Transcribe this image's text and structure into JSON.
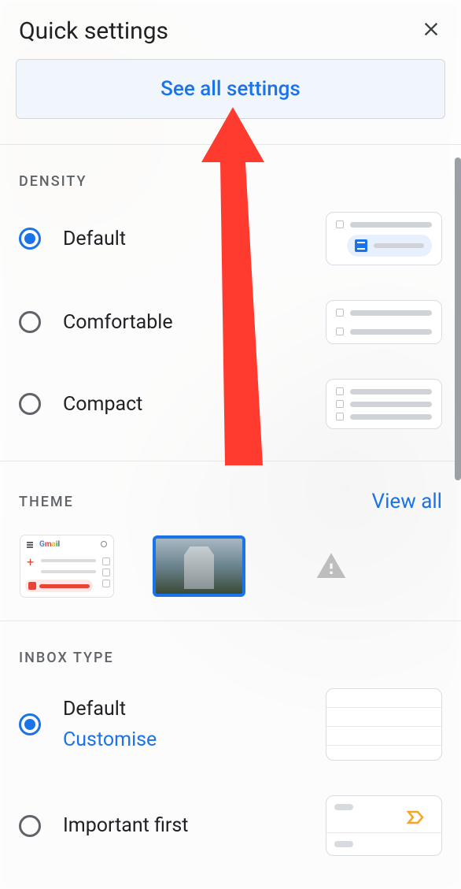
{
  "header": {
    "title": "Quick settings",
    "close_icon": "close-icon"
  },
  "see_all_button": "See all settings",
  "density": {
    "title": "DENSITY",
    "options": [
      {
        "label": "Default",
        "selected": true
      },
      {
        "label": "Comfortable",
        "selected": false
      },
      {
        "label": "Compact",
        "selected": false
      }
    ]
  },
  "theme": {
    "title": "THEME",
    "view_all": "View all",
    "thumbs": [
      {
        "name": "gmail-default-theme",
        "selected": false
      },
      {
        "name": "photo-theme",
        "selected": true
      },
      {
        "name": "high-contrast-theme",
        "selected": false
      }
    ]
  },
  "inbox_type": {
    "title": "INBOX TYPE",
    "options": [
      {
        "label": "Default",
        "customise": "Customise",
        "selected": true
      },
      {
        "label": "Important first",
        "selected": false
      }
    ]
  },
  "colors": {
    "accent": "#1a73e8",
    "text": "#202124",
    "muted": "#5f6368",
    "annotation": "#ff3b30"
  }
}
